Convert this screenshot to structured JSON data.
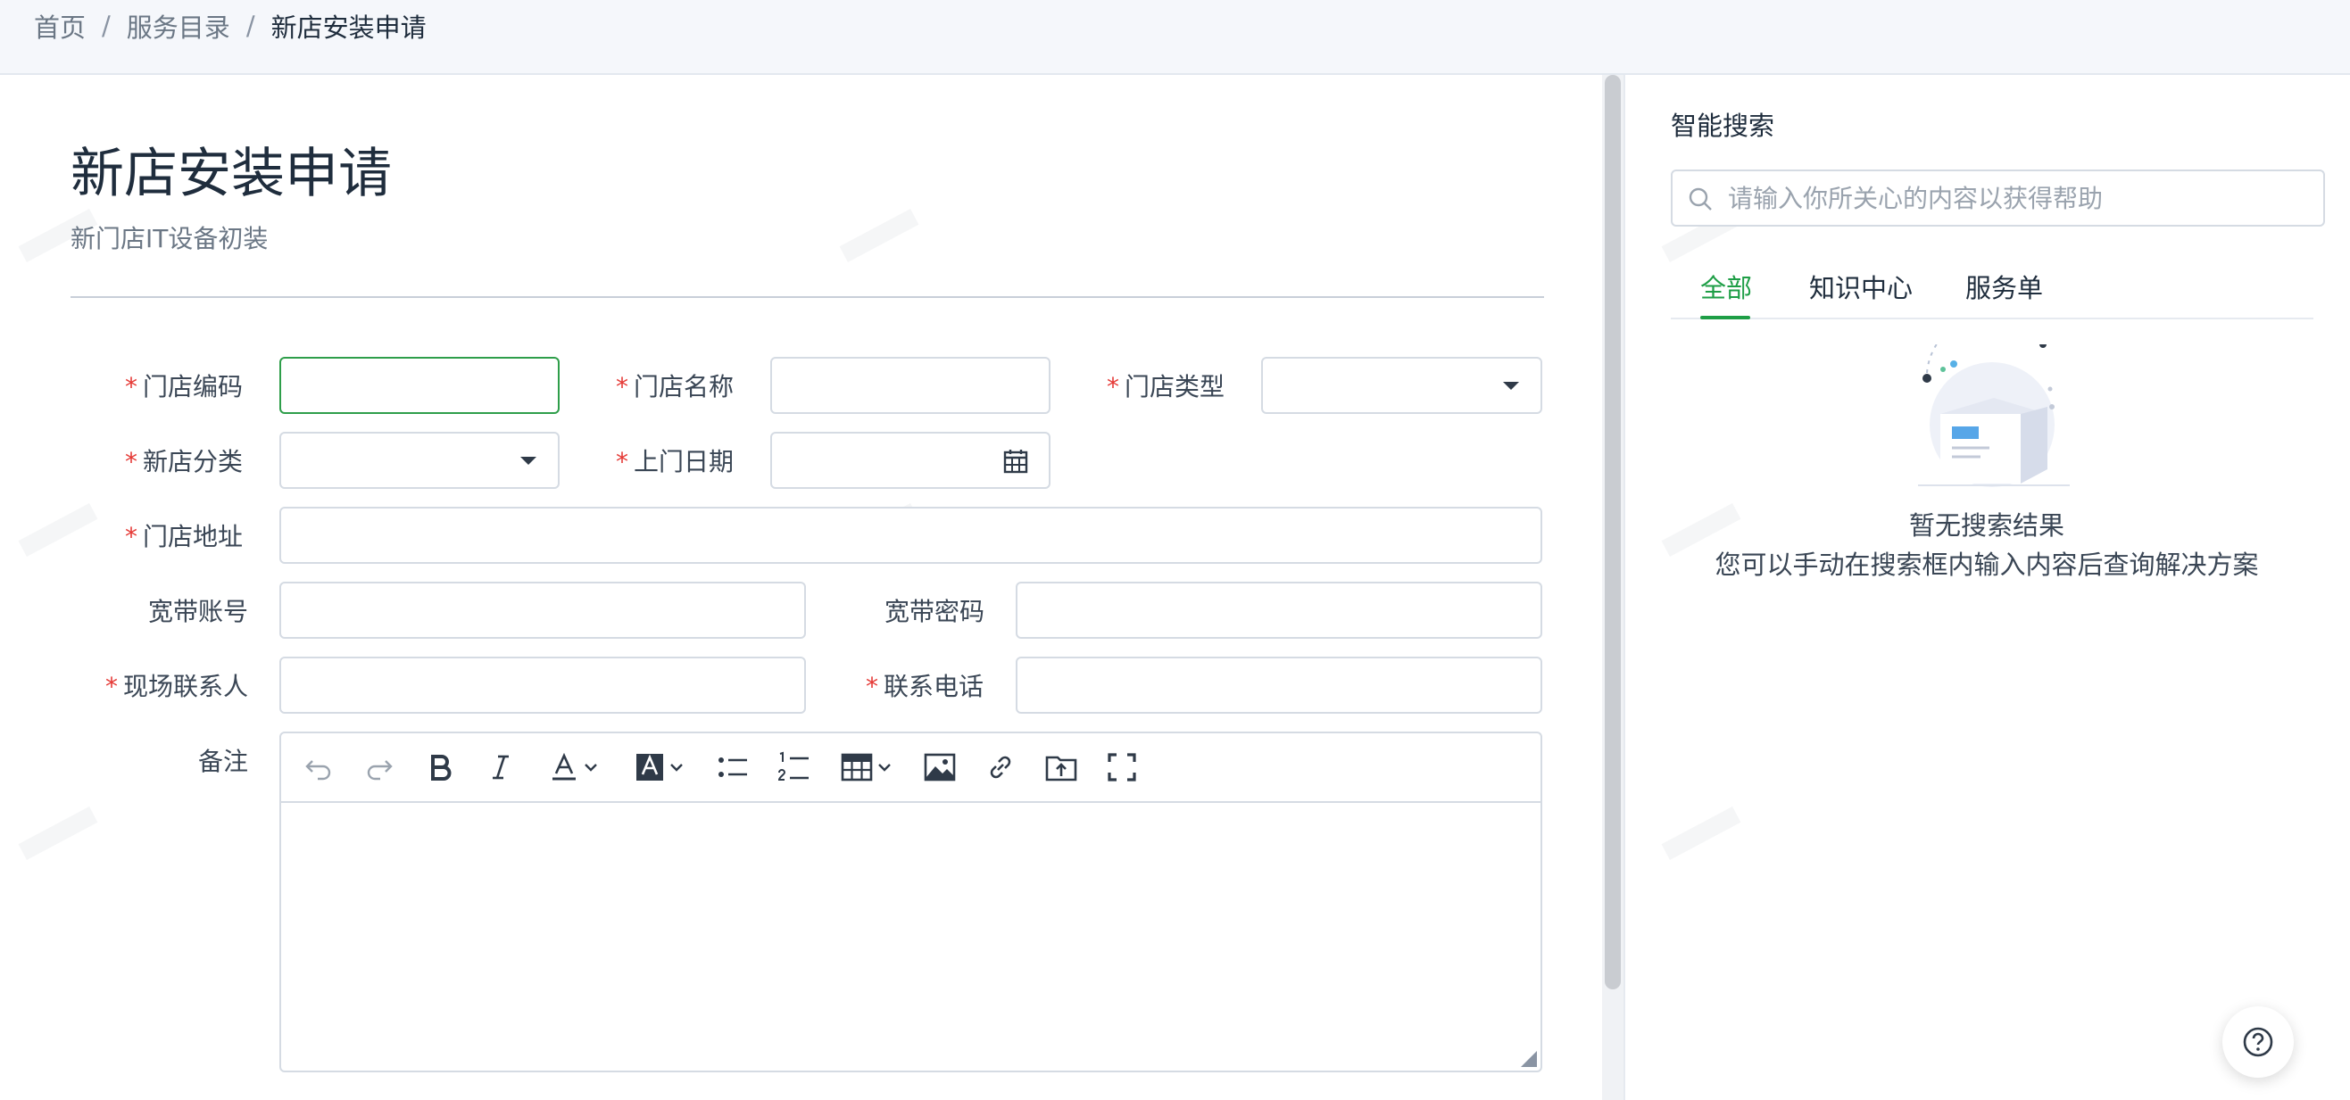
{
  "breadcrumb": {
    "items": [
      "首页",
      "服务目录",
      "新店安装申请"
    ],
    "separator": "/"
  },
  "form": {
    "title": "新店安装申请",
    "subtitle": "新门店IT设备初装",
    "fields": {
      "store_code": {
        "label": "门店编码",
        "required": true,
        "value": ""
      },
      "store_name": {
        "label": "门店名称",
        "required": true,
        "value": ""
      },
      "store_type": {
        "label": "门店类型",
        "required": true,
        "value": ""
      },
      "store_category": {
        "label": "新店分类",
        "required": true,
        "value": ""
      },
      "visit_date": {
        "label": "上门日期",
        "required": true,
        "value": ""
      },
      "store_address": {
        "label": "门店地址",
        "required": true,
        "value": ""
      },
      "broadband_account": {
        "label": "宽带账号",
        "required": false,
        "value": ""
      },
      "broadband_password": {
        "label": "宽带密码",
        "required": false,
        "value": ""
      },
      "site_contact": {
        "label": "现场联系人",
        "required": true,
        "value": ""
      },
      "contact_phone": {
        "label": "联系电话",
        "required": true,
        "value": ""
      },
      "remarks": {
        "label": "备注",
        "required": false,
        "value": ""
      }
    },
    "required_mark": "*",
    "editor_toolbar": [
      "undo-icon",
      "redo-icon",
      "bold-icon",
      "italic-icon",
      "font-color-icon",
      "background-color-icon",
      "bullet-list-icon",
      "numbered-list-icon",
      "table-icon",
      "image-icon",
      "link-icon",
      "upload-file-icon",
      "fullscreen-icon"
    ]
  },
  "panel": {
    "title": "智能搜索",
    "search_placeholder": "请输入你所关心的内容以获得帮助",
    "tabs": [
      {
        "label": "全部",
        "active": true
      },
      {
        "label": "知识中心",
        "active": false
      },
      {
        "label": "服务单",
        "active": false
      }
    ],
    "empty_title": "暂无搜索结果",
    "empty_desc": "您可以手动在搜索框内输入内容后查询解决方案"
  },
  "colors": {
    "accent_green": "#1e9e46",
    "required_red": "#e53935",
    "border": "#d5dbe3",
    "focus_border": "#2e9e4a"
  }
}
